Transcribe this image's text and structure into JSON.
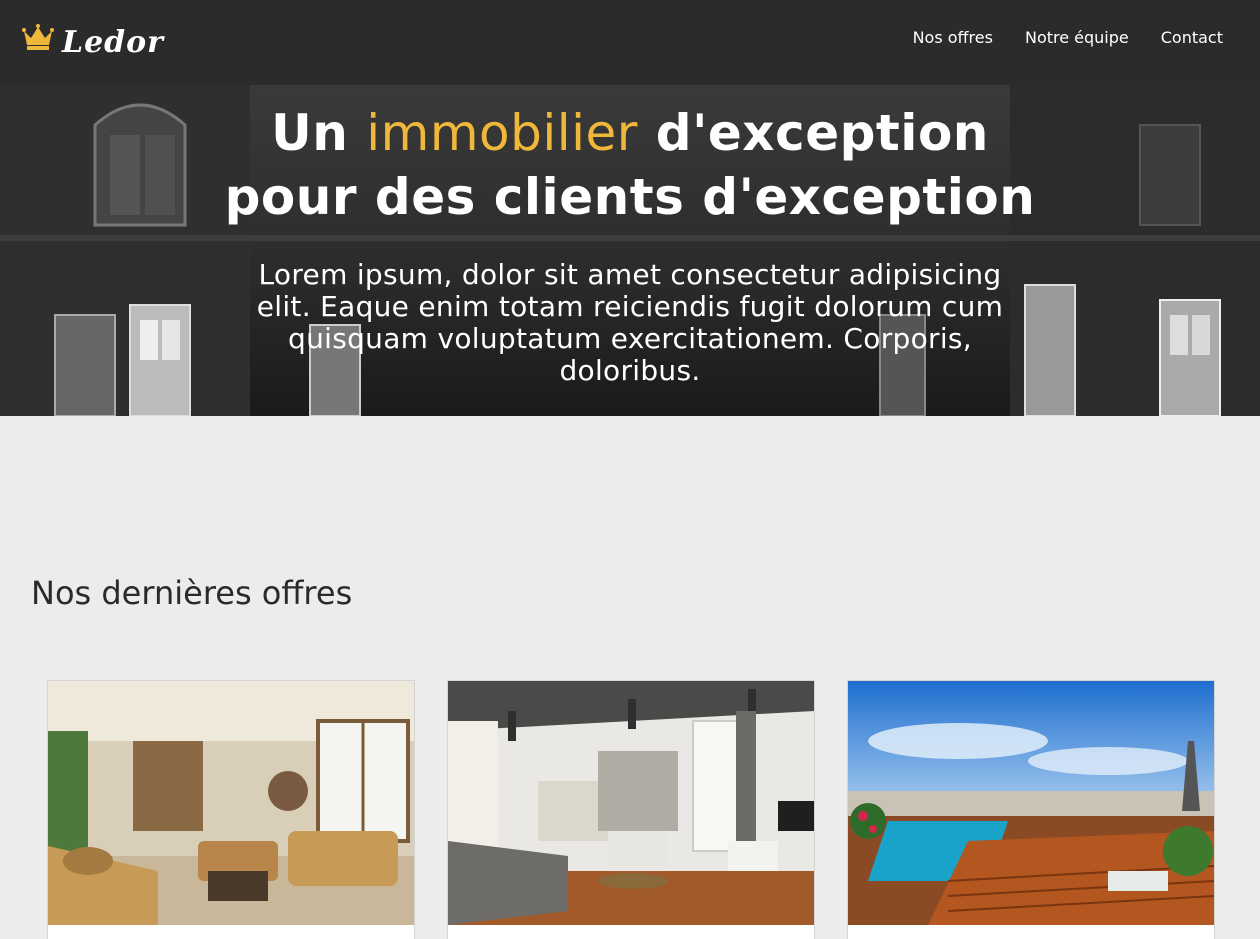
{
  "header": {
    "logo_text": "Ledor",
    "logo_icon": "crown-icon",
    "nav": [
      {
        "label": "Nos offres"
      },
      {
        "label": "Notre équipe"
      },
      {
        "label": "Contact"
      }
    ]
  },
  "hero": {
    "title_prefix": "Un",
    "title_accent": "immobilier",
    "title_line1_suffix": "d'exception",
    "title_line2": "pour des clients d'exception",
    "subtitle": "Lorem ipsum, dolor sit amet consectetur adipisicing elit. Eaque enim totam reiciendis fugit dolorum cum quisquam voluptatum exercitationem. Corporis, doloribus."
  },
  "offers": {
    "title": "Nos dernières offres",
    "cards": [
      {
        "image": "living-room-leopard-sofas-photo"
      },
      {
        "image": "white-living-room-grey-sofa-photo"
      },
      {
        "image": "rooftop-pool-terrace-paris-photo"
      }
    ]
  },
  "colors": {
    "header_bg": "#2b2b2b",
    "accent": "#f0b83a",
    "page_bg": "#ececec"
  }
}
